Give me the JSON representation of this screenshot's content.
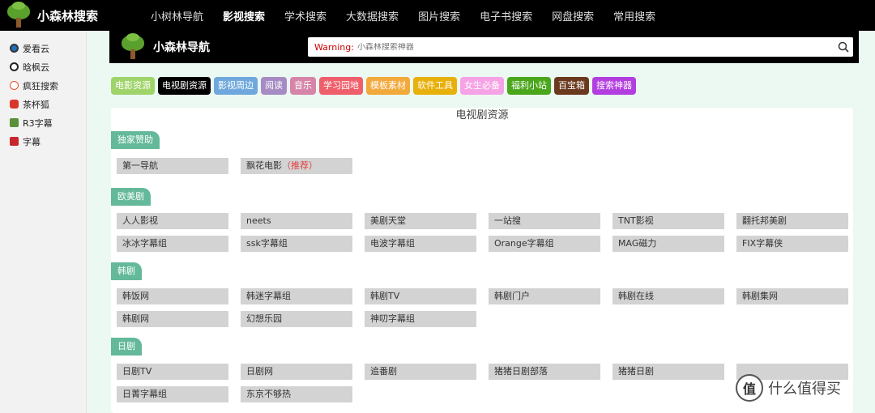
{
  "topnav": {
    "brand": "小森林搜索",
    "items": [
      "小树林导航",
      "影视搜索",
      "学术搜索",
      "大数据搜索",
      "图片搜索",
      "电子书搜索",
      "网盘搜索",
      "常用搜索"
    ],
    "active_index": 1
  },
  "sidebar": {
    "items": [
      {
        "label": "爱看云",
        "icon": "video-play-icon"
      },
      {
        "label": "晗枫云",
        "icon": "play-circle-icon"
      },
      {
        "label": "疯狂搜索",
        "icon": "search-e-icon"
      },
      {
        "label": "茶杯狐",
        "icon": "cup-fox-icon"
      },
      {
        "label": "R3字幕",
        "icon": "subtitle-r3-icon"
      },
      {
        "label": "字幕",
        "icon": "subtitle-icon"
      }
    ]
  },
  "subheader": {
    "title": "小森林导航",
    "search": {
      "warning": "Warning:",
      "placeholder": "小森林搜索神器"
    }
  },
  "tabs": [
    {
      "label": "电影资源",
      "color": "#9fd46a"
    },
    {
      "label": "电视剧资源",
      "color": "#000000"
    },
    {
      "label": "影视周边",
      "color": "#6fa8dc"
    },
    {
      "label": "阅读",
      "color": "#a78bc4"
    },
    {
      "label": "音乐",
      "color": "#d685a8"
    },
    {
      "label": "学习园地",
      "color": "#ef5f6b"
    },
    {
      "label": "模板素材",
      "color": "#f2a93b"
    },
    {
      "label": "软件工具",
      "color": "#e8b00a"
    },
    {
      "label": "女生必备",
      "color": "#f6a3e6"
    },
    {
      "label": "福利小站",
      "color": "#4aa61b"
    },
    {
      "label": "百宝箱",
      "color": "#6b3a1e"
    },
    {
      "label": "搜索神器",
      "color": "#b23ee0"
    }
  ],
  "panel": {
    "title": "电视剧资源",
    "sections": [
      {
        "label": "独家赞助",
        "links": [
          "第一导航",
          "飘花电影"
        ],
        "rec_note": "（推荐）"
      },
      {
        "label": "欧美剧",
        "links": [
          "人人影视",
          "neets",
          "美剧天堂",
          "一站搜",
          "TNT影视",
          "翻托邦美剧",
          "冰冰字幕组",
          "ssk字幕组",
          "电波字幕组",
          "Orange字幕组",
          "MAG磁力",
          "FIX字幕侠"
        ]
      },
      {
        "label": "韩剧",
        "links": [
          "韩饭网",
          "韩迷字幕组",
          "韩剧TV",
          "韩剧门户",
          "韩剧在线",
          "韩剧集网",
          "韩剧网",
          "幻想乐园",
          "神叨字幕组"
        ]
      },
      {
        "label": "日剧",
        "links": [
          "日剧TV",
          "日剧网",
          "追番剧",
          "猪猪日剧部落",
          "猪猪日剧",
          "",
          "日菁字幕组",
          "东京不够热"
        ]
      }
    ]
  },
  "watermark": {
    "badge": "值",
    "text": "什么值得买"
  }
}
